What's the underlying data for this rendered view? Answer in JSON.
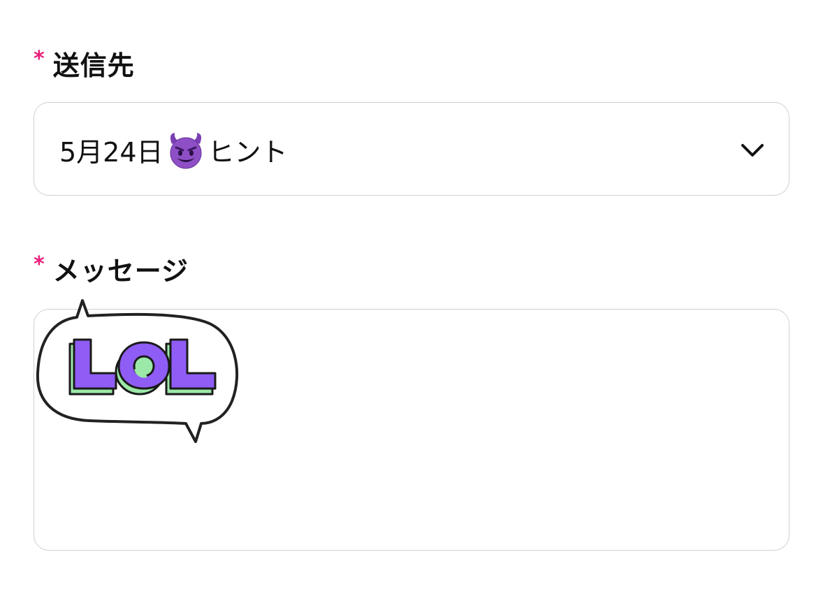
{
  "recipient": {
    "required_mark": "*",
    "label": "送信先",
    "selected_prefix": "5月24日",
    "selected_emoji_icon": "smiling-devil-face-icon",
    "selected_suffix": "ヒント",
    "dropdown_icon": "chevron-down-icon"
  },
  "message": {
    "required_mark": "*",
    "label": "メッセージ",
    "sticker": {
      "icon": "lol-speech-bubble-sticker",
      "text": "LOL"
    }
  },
  "colors": {
    "required_mark": "#ec1d7a",
    "field_border": "#cfcfcf",
    "sticker_letter_fill": "#8f5cf6",
    "sticker_letter_shadow": "#9be8a8",
    "emoji_purple": "#8e4fc6"
  }
}
